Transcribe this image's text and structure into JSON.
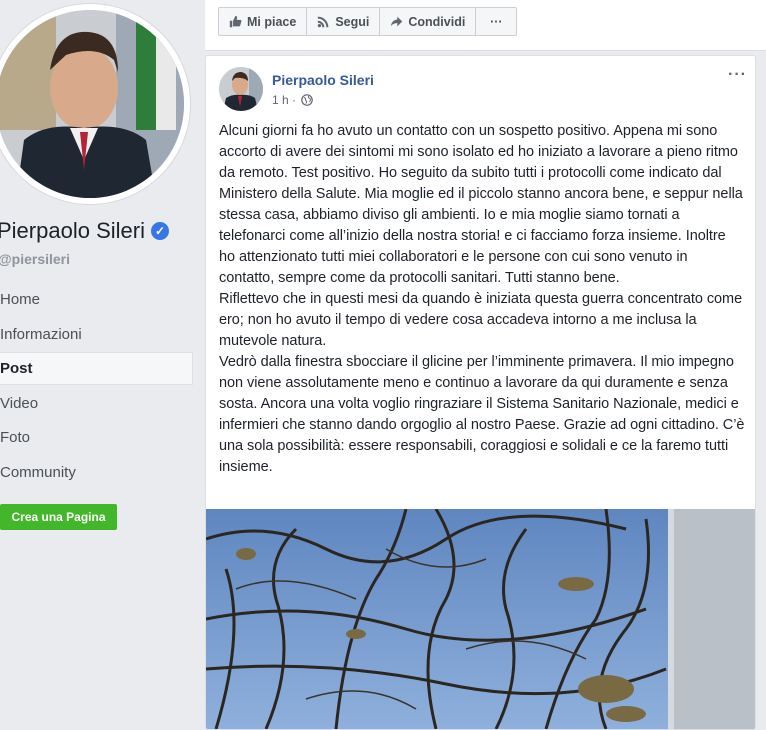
{
  "sidebar": {
    "page_name": "Pierpaolo Sileri",
    "handle": "@piersileri",
    "nav": [
      "Home",
      "Informazioni",
      "Post",
      "Video",
      "Foto",
      "Community"
    ],
    "active_nav": "Post",
    "create_page": "Crea una Pagina"
  },
  "topbar": {
    "like": "Mi piace",
    "follow": "Segui",
    "share": "Condividi",
    "more": "···"
  },
  "post": {
    "author": "Pierpaolo Sileri",
    "time": "1 h ·",
    "audience_icon": "globe-icon",
    "more": "···",
    "text": "Alcuni giorni fa ho avuto un contatto con un sospetto positivo. Appena mi sono accorto di avere dei sintomi mi sono isolato ed ho iniziato a lavorare a pieno ritmo da remoto. Test positivo. Ho seguito da subito tutti i protocolli come indicato dal Ministero della Salute. Mia moglie ed il piccolo stanno ancora bene, e seppur nella stessa casa, abbiamo diviso gli ambienti. Io e mia moglie siamo tornati a telefonarci come all’inizio della nostra storia! e ci facciamo forza insieme. Inoltre ho attenzionato tutti miei collaboratori e le persone con cui sono venuto in contatto, sempre come da protocolli sanitari. Tutti stanno bene.\nRiflettevo che in questi mesi da quando è iniziata questa guerra concentrato come ero; non ho avuto il tempo di vedere cosa accadeva intorno a me inclusa la mutevole natura.\nVedrò dalla finestra sbocciare il glicine per l’imminente primavera. Il mio impegno non viene assolutamente meno e continuo a lavorare da qui duramente e senza sosta. Ancora una volta voglio ringraziare il Sistema Sanitario Nazionale, medici e infermieri che stanno dando orgoglio al nostro Paese. Grazie ad ogni cittadino. C’è una sola possibilità: essere responsabili, coraggiosi e solidali e ce la faremo tutti insieme."
  },
  "colors": {
    "link": "#385898",
    "verified": "#3578e5",
    "create_button": "#42b72a",
    "background": "#e9ebee"
  }
}
